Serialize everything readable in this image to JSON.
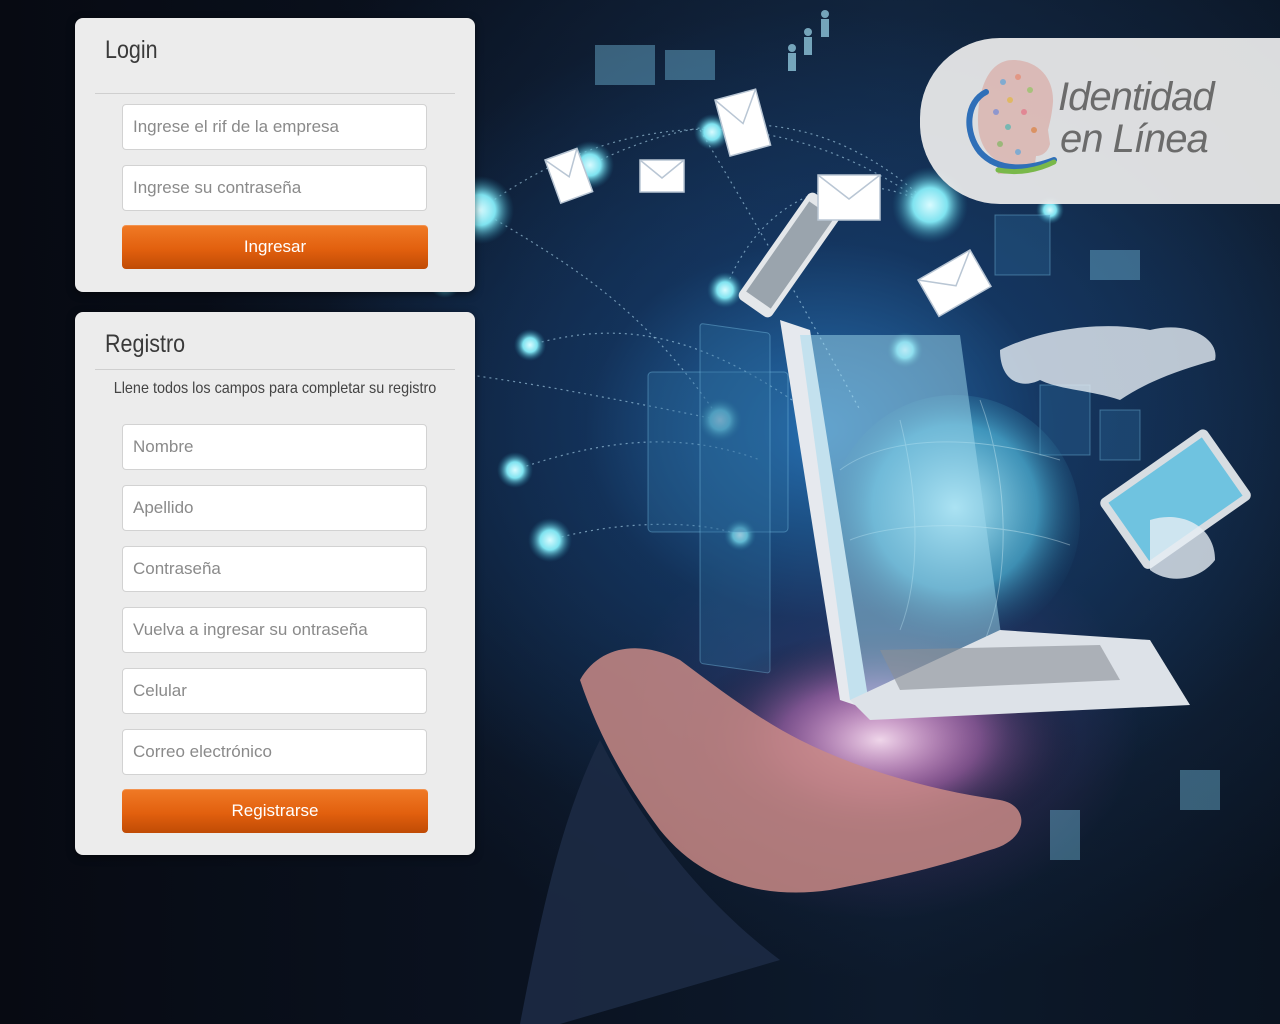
{
  "login": {
    "title": "Login",
    "rif_placeholder": "Ingrese el rif de la empresa",
    "password_placeholder": "Ingrese su contraseña",
    "submit_label": "Ingresar"
  },
  "register": {
    "title": "Registro",
    "subtitle": "Llene todos los campos para completar su registro",
    "name_placeholder": "Nombre",
    "lastname_placeholder": "Apellido",
    "password_placeholder": "Contraseña",
    "password_repeat_placeholder": "Vuelva a ingresar su ontraseña",
    "phone_placeholder": "Celular",
    "email_placeholder": "Correo electrónico",
    "submit_label": "Registrarse"
  },
  "brand": {
    "line1": "Identidad",
    "line2": "en Línea"
  },
  "colors": {
    "accent": "#e2600e",
    "panel_bg": "#ececec",
    "background": "#05080f"
  }
}
